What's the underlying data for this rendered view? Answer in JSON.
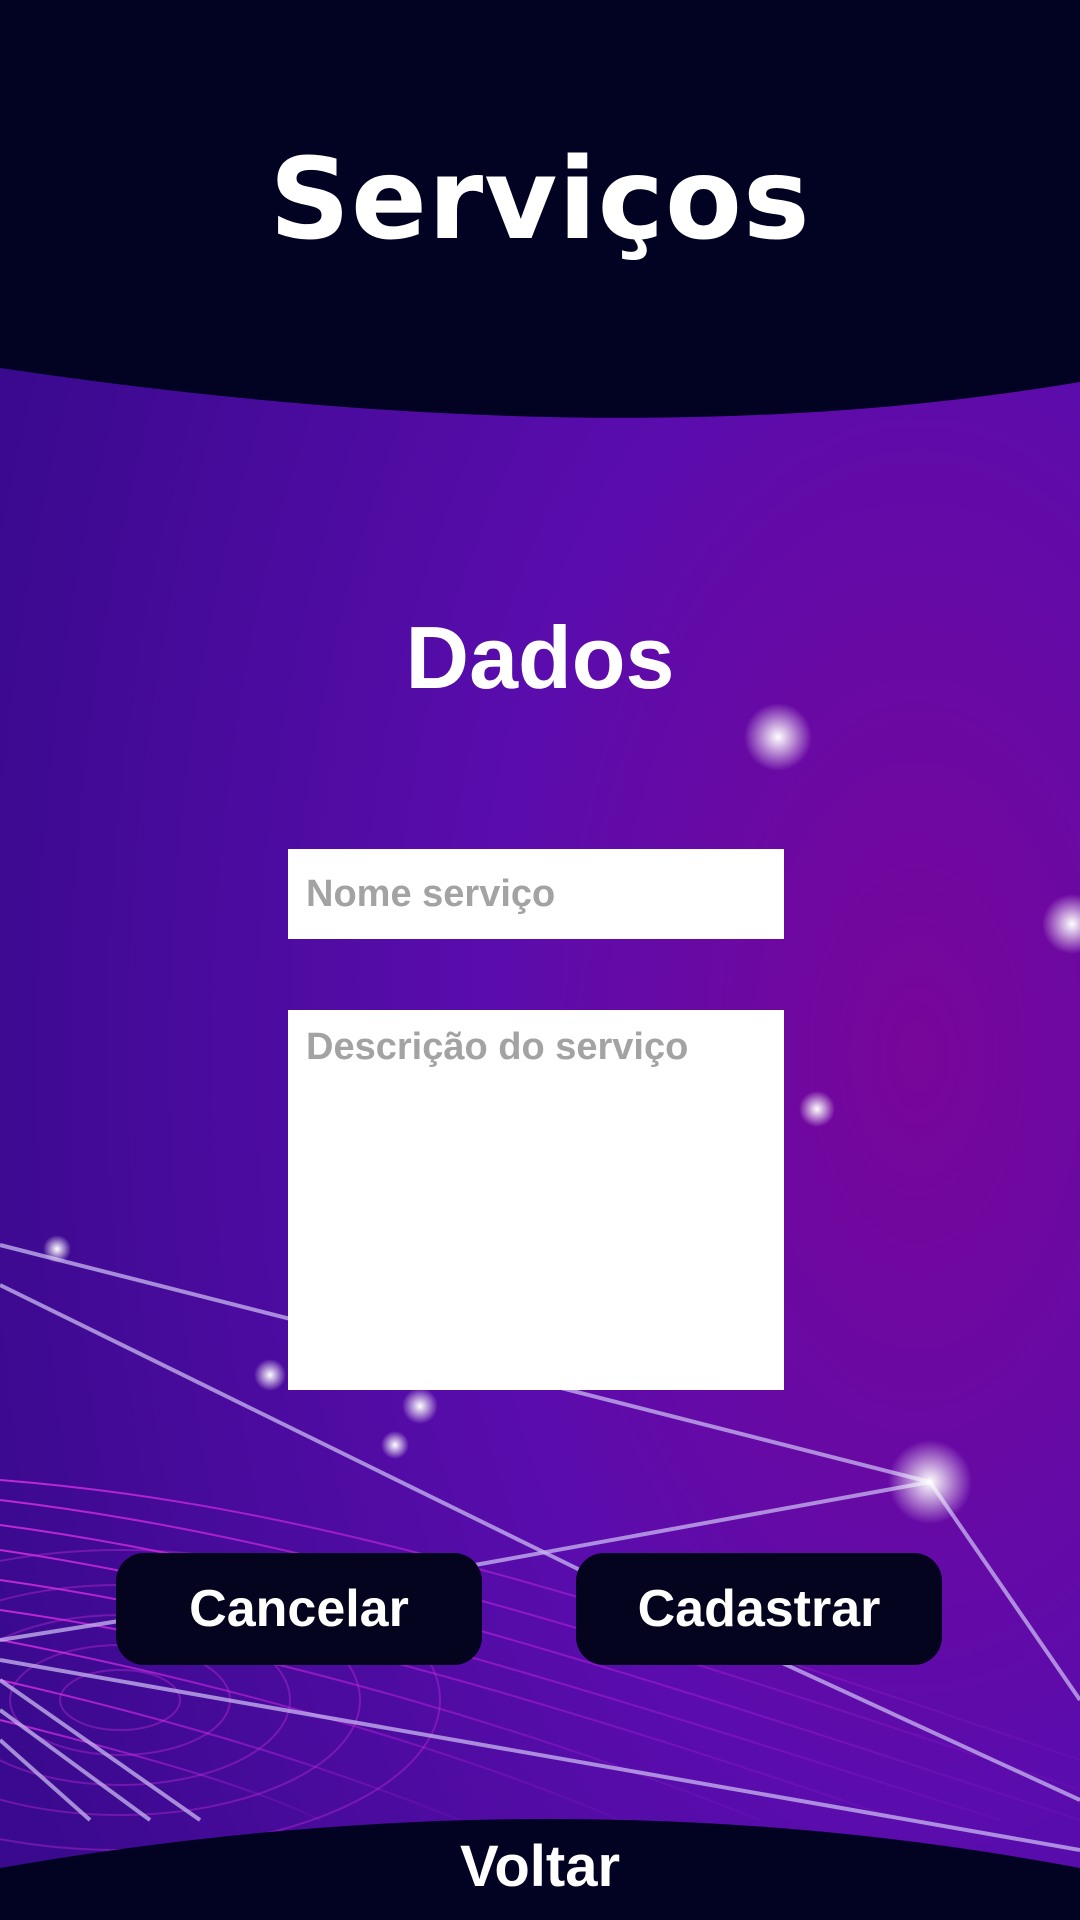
{
  "header": {
    "title": "Serviços"
  },
  "section": {
    "title": "Dados"
  },
  "form": {
    "name_placeholder": "Nome serviço",
    "name_value": "",
    "description_placeholder": "Descrição do serviço",
    "description_value": ""
  },
  "actions": {
    "cancel_label": "Cancelar",
    "submit_label": "Cadastrar"
  },
  "footer": {
    "back_label": "Voltar"
  },
  "colors": {
    "dark_band": "#020222",
    "background_purple": "#4a0aa0",
    "accent_magenta": "#c020d0",
    "field_background": "#ffffff",
    "placeholder_text": "#a3a3a3"
  }
}
